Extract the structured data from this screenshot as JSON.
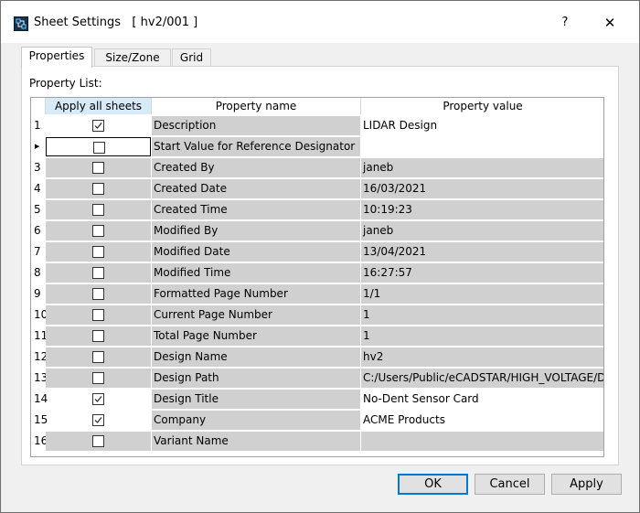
{
  "window": {
    "title": "Sheet Settings   [ hv2/001 ]",
    "help_label": "?",
    "close_label": "✕"
  },
  "tabs": [
    {
      "label": "Properties",
      "active": true
    },
    {
      "label": "Size/Zone",
      "active": false
    },
    {
      "label": "Grid",
      "active": false
    }
  ],
  "panel": {
    "property_list_label": "Property List:",
    "columns": {
      "apply": "Apply all sheets",
      "name": "Property name",
      "value": "Property value"
    },
    "rows": [
      {
        "num": "1",
        "apply": true,
        "name": "Description",
        "value": "LIDAR Design",
        "editable": true
      },
      {
        "num": "",
        "apply": false,
        "name": "Start Value for Reference Designator",
        "value": "",
        "editable": true,
        "current": true
      },
      {
        "num": "3",
        "apply": false,
        "name": "Created By",
        "value": "janeb",
        "editable": false
      },
      {
        "num": "4",
        "apply": false,
        "name": "Created Date",
        "value": "16/03/2021",
        "editable": false
      },
      {
        "num": "5",
        "apply": false,
        "name": "Created Time",
        "value": "10:19:23",
        "editable": false
      },
      {
        "num": "6",
        "apply": false,
        "name": "Modified By",
        "value": "janeb",
        "editable": false
      },
      {
        "num": "7",
        "apply": false,
        "name": "Modified Date",
        "value": "13/04/2021",
        "editable": false
      },
      {
        "num": "8",
        "apply": false,
        "name": "Modified Time",
        "value": "16:27:57",
        "editable": false
      },
      {
        "num": "9",
        "apply": false,
        "name": "Formatted Page Number",
        "value": "1/1",
        "editable": false
      },
      {
        "num": "10",
        "apply": false,
        "name": "Current Page Number",
        "value": "1",
        "editable": false
      },
      {
        "num": "11",
        "apply": false,
        "name": "Total Page Number",
        "value": "1",
        "editable": false
      },
      {
        "num": "12",
        "apply": false,
        "name": "Design Name",
        "value": "hv2",
        "editable": false
      },
      {
        "num": "13",
        "apply": false,
        "name": "Design Path",
        "value": "C:/Users/Public/eCADSTAR/HIGH_VOLTAGE/D...",
        "editable": false
      },
      {
        "num": "14",
        "apply": true,
        "name": "Design Title",
        "value": "No-Dent Sensor Card",
        "editable": true
      },
      {
        "num": "15",
        "apply": true,
        "name": "Company",
        "value": "ACME Products",
        "editable": true
      },
      {
        "num": "16",
        "apply": false,
        "name": "Variant Name",
        "value": "",
        "editable": false
      }
    ]
  },
  "buttons": {
    "ok": "OK",
    "cancel": "Cancel",
    "apply": "Apply"
  },
  "icons": {
    "row_indicator": "current-row-indicator-icon",
    "check": "checkmark-icon",
    "app": "ecadstar-app-icon"
  }
}
